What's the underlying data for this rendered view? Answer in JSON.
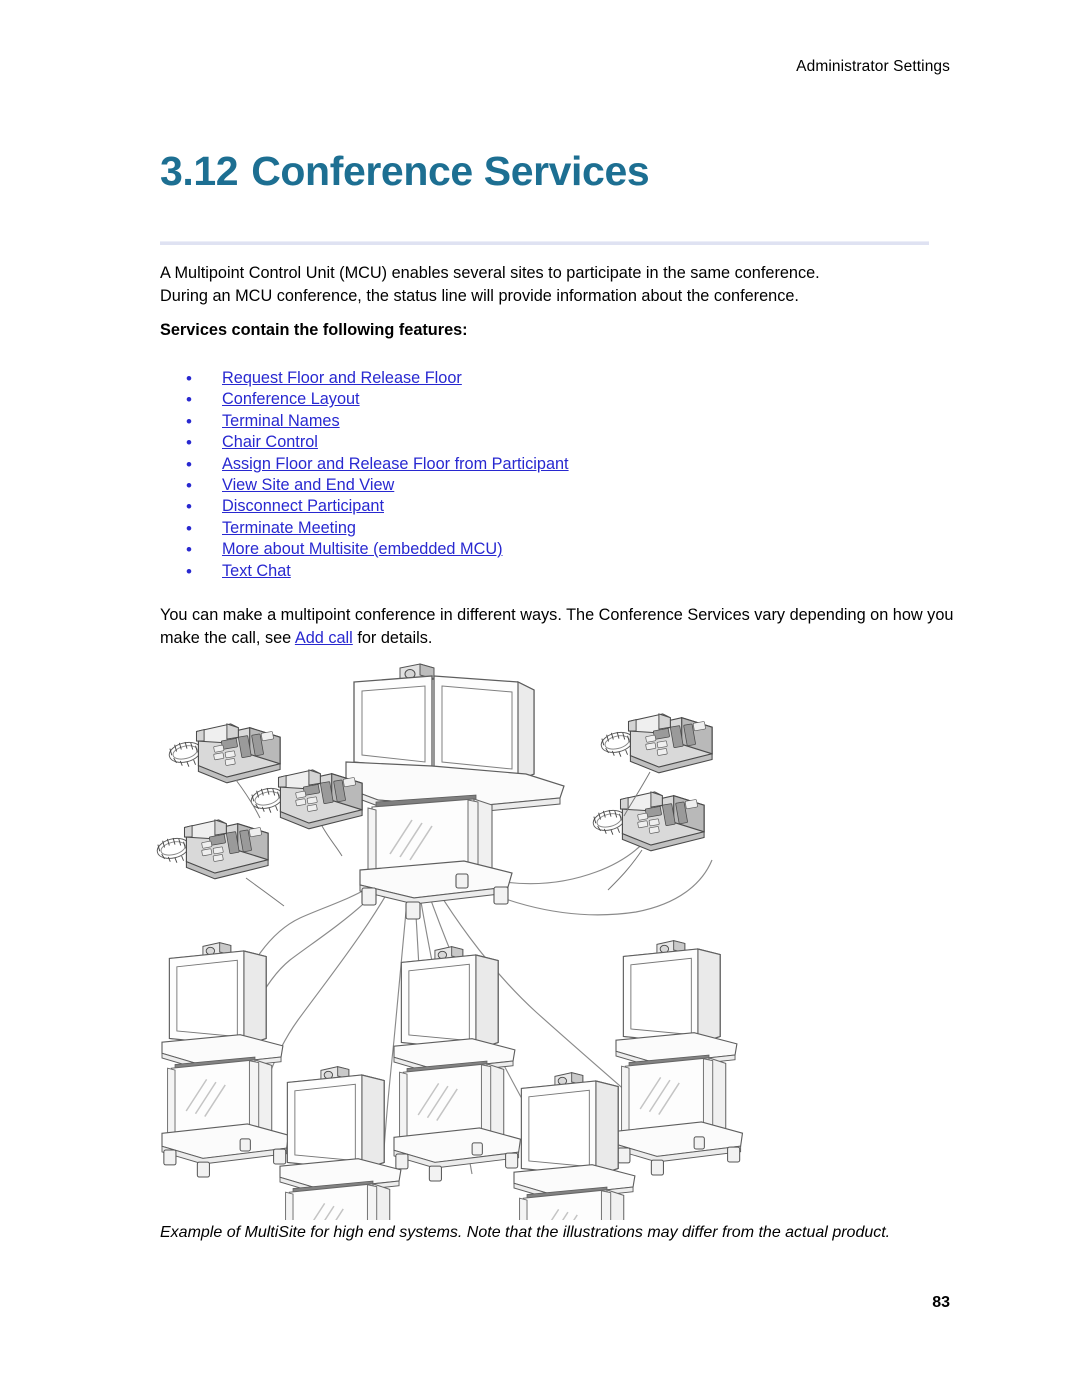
{
  "header": {
    "running_title": "Administrator Settings"
  },
  "title": {
    "number": "3.12",
    "text": "Conference Services",
    "color": "#1d6f92"
  },
  "intro": {
    "line1": "A Multipoint Control Unit (MCU) enables several sites to participate in the same conference.",
    "line2": "During an MCU conference, the status line will provide information about the conference."
  },
  "subhead": "Services contain the following features:",
  "features": {
    "bullet_glyph": "•",
    "link_color": "#2828d0",
    "items": [
      "Request Floor and Release Floor",
      "Conference Layout",
      "Terminal Names",
      "Chair Control",
      "Assign Floor and Release Floor from Participant",
      "View Site and End View",
      "Disconnect Participant",
      "Terminate Meeting",
      "More about Multisite (embedded MCU)",
      "Text Chat"
    ]
  },
  "paragraph2": {
    "before_link": "You can make a multipoint conference in different ways. The Conference Services vary depending on how you make the call, see ",
    "link": "Add call",
    "after_link": " for details."
  },
  "illustration": {
    "alt": "Example diagram of a MultiSite multipoint conference: a central dual-monitor video system connected by lines to five telephones and five single-monitor video systems.",
    "central_unit": "dual-monitor-video-cart",
    "phones_count": 5,
    "video_carts_count": 5
  },
  "caption": {
    "line1": "Example of MultiSite for high end systems. Note that the illustrations may differ from the actual",
    "line2": "product."
  },
  "page_number": "83"
}
